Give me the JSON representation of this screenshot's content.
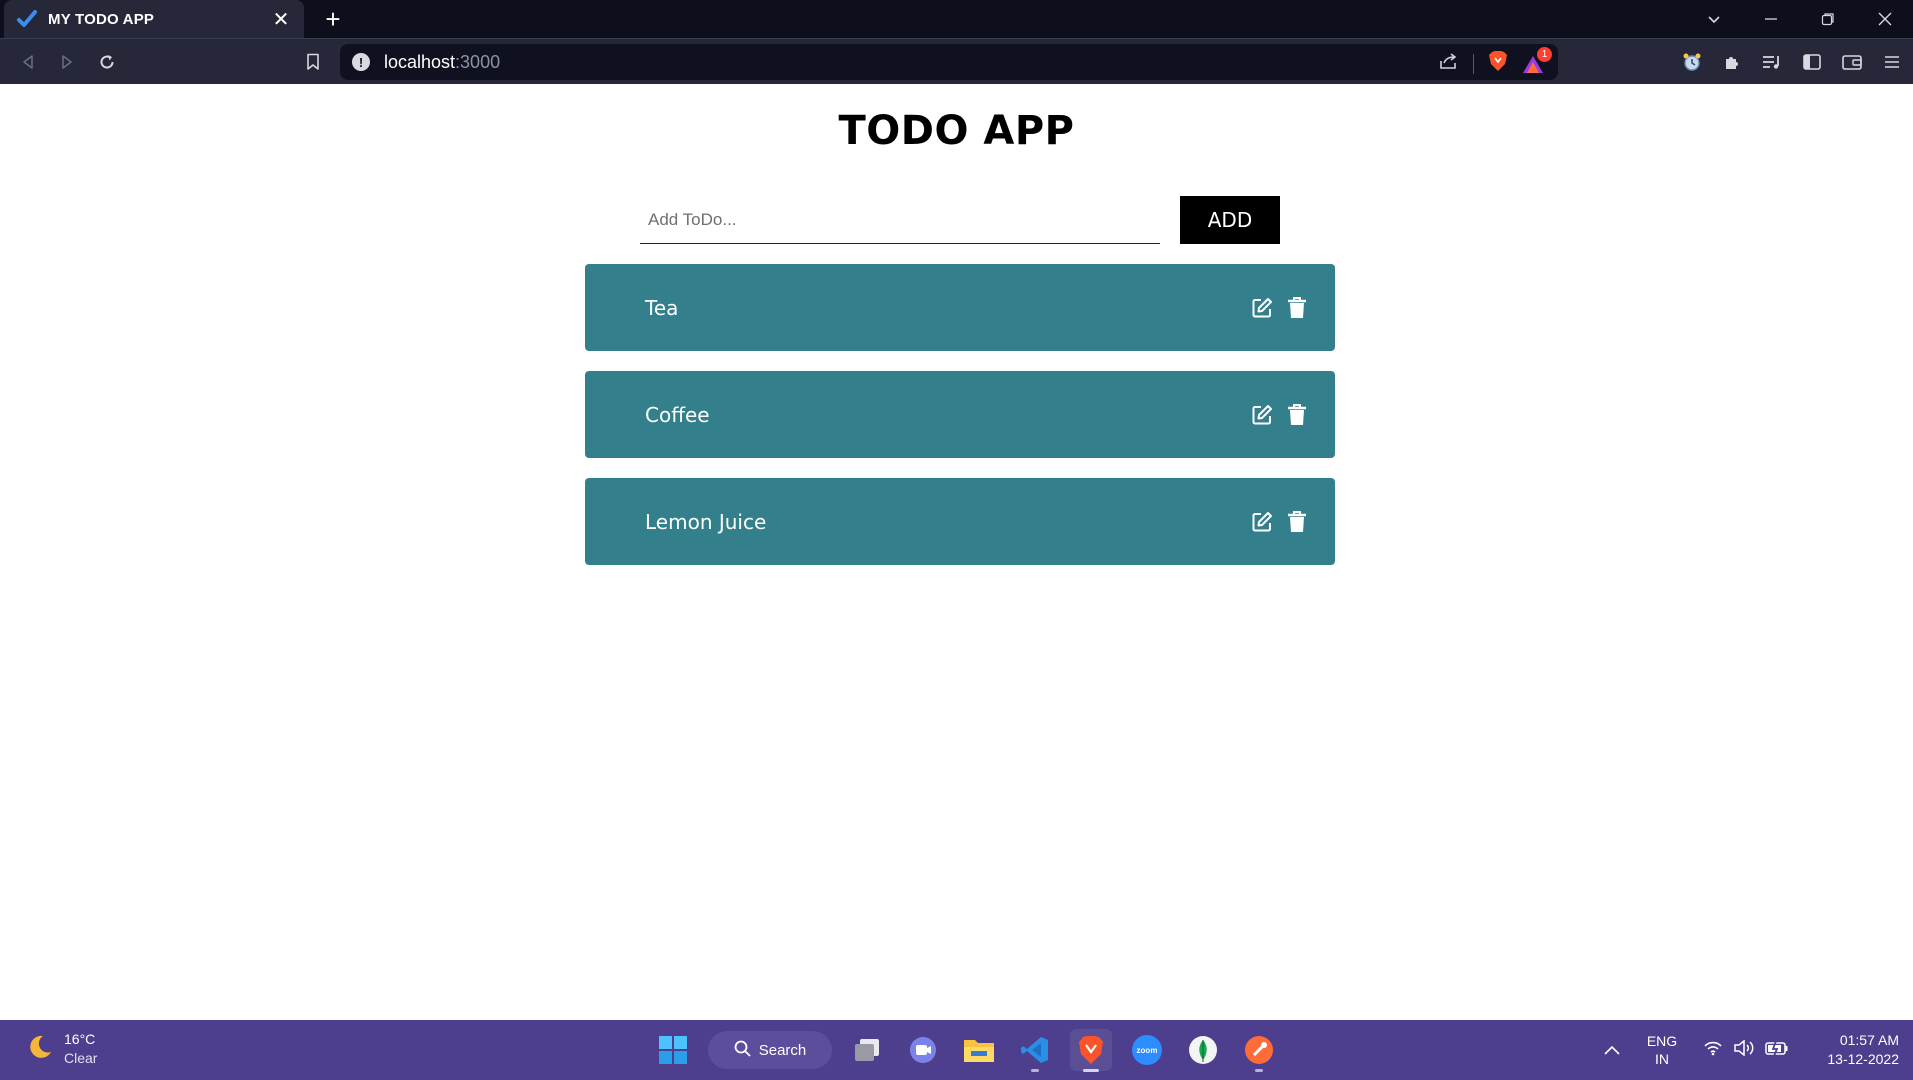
{
  "browser": {
    "tab": {
      "title": "MY TODO APP",
      "close_glyph": "✕"
    },
    "new_tab_glyph": "+",
    "url": {
      "host": "localhost",
      "port": ":3000"
    },
    "notification_count": "1"
  },
  "app": {
    "title": "TODO APP",
    "input": {
      "placeholder": "Add ToDo...",
      "value": ""
    },
    "add_label": "ADD",
    "todos": [
      {
        "text": "Tea"
      },
      {
        "text": "Coffee"
      },
      {
        "text": "Lemon Juice"
      }
    ],
    "colors": {
      "item_bg": "#347f8c",
      "button_bg": "#000000"
    }
  },
  "taskbar": {
    "weather": {
      "temp": "16°C",
      "condition": "Clear"
    },
    "search_label": "Search",
    "lang": {
      "line1": "ENG",
      "line2": "IN"
    },
    "clock": {
      "time": "01:57 AM",
      "date": "13-12-2022"
    },
    "background": "#4d3f8d"
  }
}
